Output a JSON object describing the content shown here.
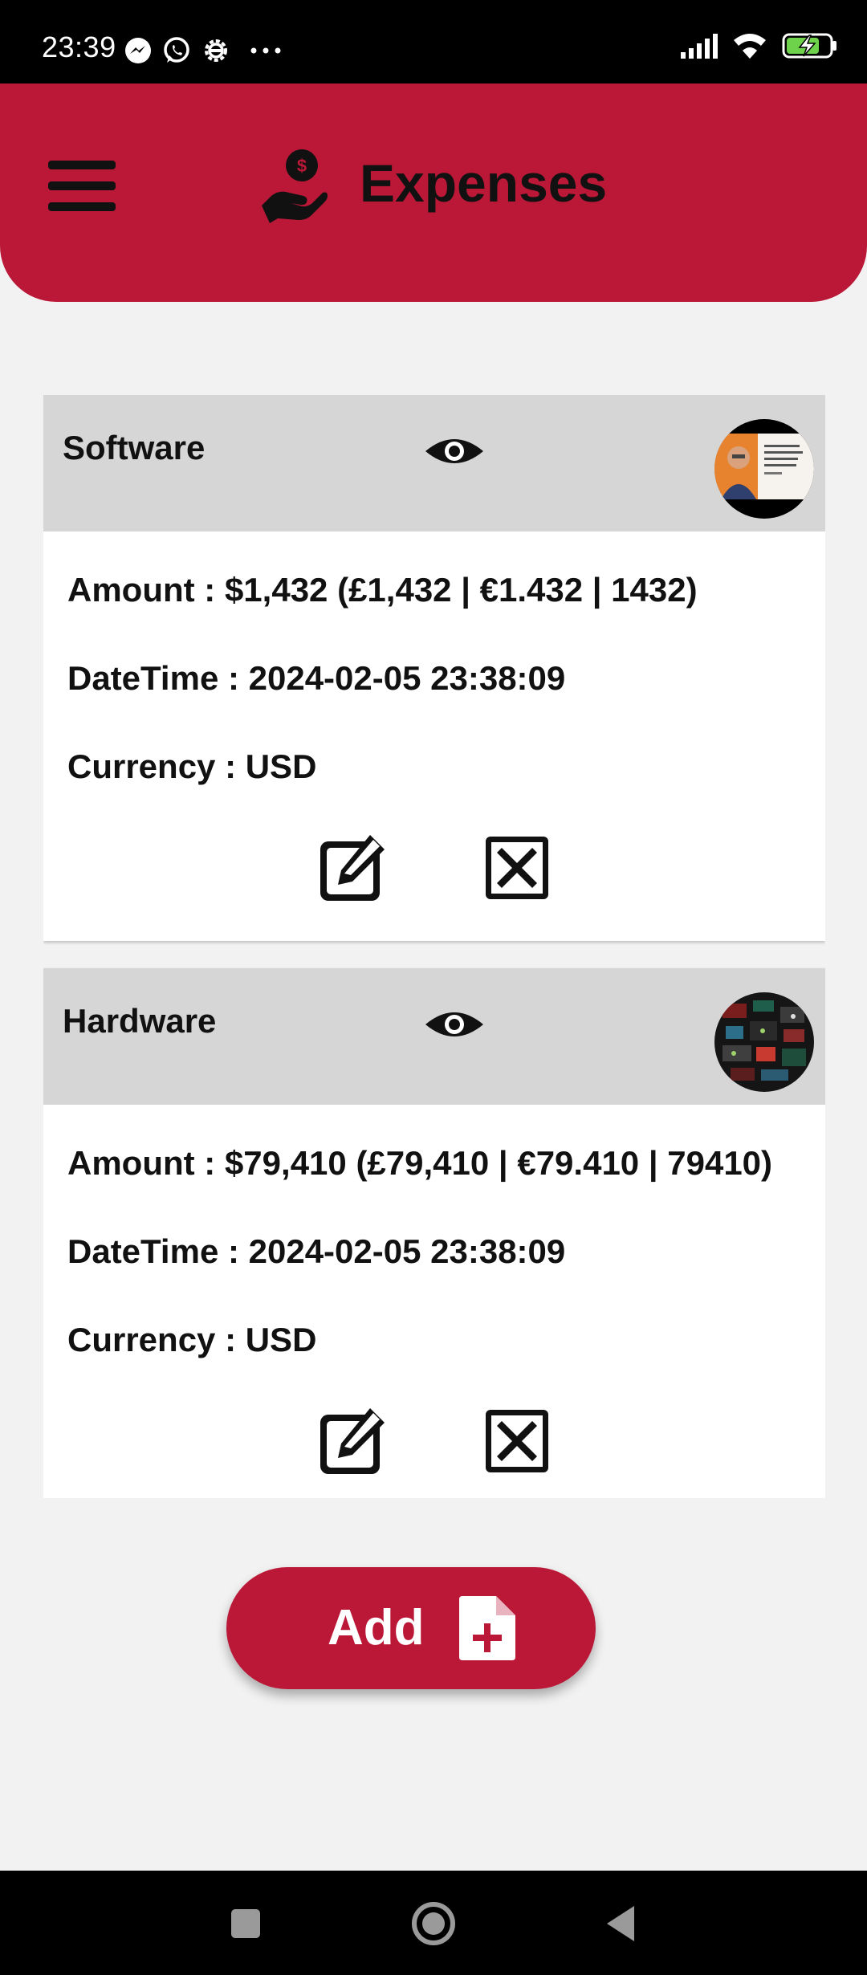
{
  "status_bar": {
    "time": "23:39",
    "left_icons": [
      "messenger-icon",
      "whatsapp-icon",
      "settings-gear-icon",
      "more-dots-icon"
    ],
    "right_icons": [
      "signal-icon",
      "wifi-icon",
      "battery-charging-icon"
    ]
  },
  "header": {
    "title": "Expenses",
    "menu_icon": "hamburger-menu-icon",
    "title_icon": "hand-holding-dollar-icon"
  },
  "expenses": [
    {
      "name": "Software",
      "amount_line": "Amount : $1,432 (£1,432 | €1.432 | 1432)",
      "datetime_line": "DateTime : 2024-02-05 23:38:09",
      "currency_line": "Currency : USD"
    },
    {
      "name": "Hardware",
      "amount_line": "Amount : $79,410 (£79,410 | €79.410 | 79410)",
      "datetime_line": "DateTime : 2024-02-05 23:38:09",
      "currency_line": "Currency : USD"
    }
  ],
  "add_button": {
    "label": "Add"
  },
  "colors": {
    "brand": "#bb1838",
    "card_header": "#d6d6d6",
    "background": "#f2f2f2"
  }
}
